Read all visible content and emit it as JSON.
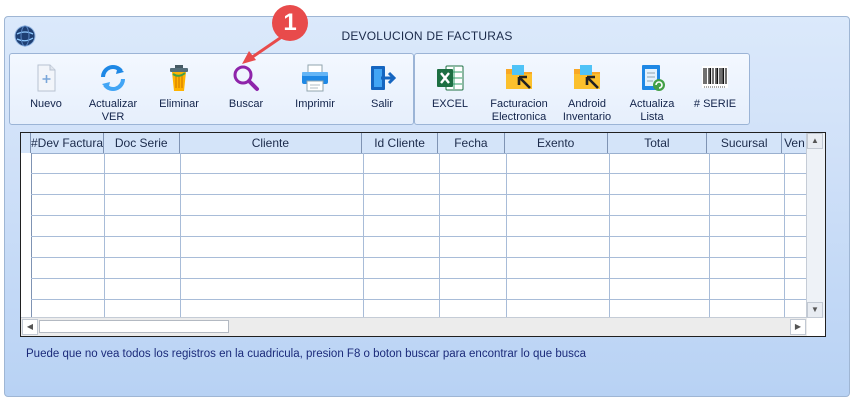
{
  "window": {
    "title": "DEVOLUCION DE FACTURAS"
  },
  "callout": {
    "number": "1"
  },
  "toolbar_left": [
    {
      "id": "nuevo",
      "label": "Nuevo",
      "icon": "doc-plus-icon"
    },
    {
      "id": "actualizar",
      "label": "Actualizar\nVER",
      "icon": "refresh-icon"
    },
    {
      "id": "eliminar",
      "label": "Eliminar",
      "icon": "trash-icon"
    },
    {
      "id": "buscar",
      "label": "Buscar",
      "icon": "search-icon"
    },
    {
      "id": "imprimir",
      "label": "Imprimir",
      "icon": "printer-icon"
    },
    {
      "id": "salir",
      "label": "Salir",
      "icon": "exit-icon"
    }
  ],
  "toolbar_right": [
    {
      "id": "excel",
      "label": "EXCEL",
      "icon": "excel-icon"
    },
    {
      "id": "facturacion",
      "label": "Facturacion\nElectronica",
      "icon": "folder-arrow-icon"
    },
    {
      "id": "android",
      "label": "Android\nInventario",
      "icon": "folder-arrow-icon"
    },
    {
      "id": "actualiza",
      "label": "Actualiza\nLista",
      "icon": "list-refresh-icon"
    },
    {
      "id": "serie",
      "label": "# SERIE",
      "icon": "barcode-icon"
    }
  ],
  "grid": {
    "columns": [
      "#Dev Factura",
      "Doc Serie",
      "Cliente",
      "Id Cliente",
      "Fecha",
      "Exento",
      "Total",
      "Sucursal",
      "Ven"
    ]
  },
  "status": {
    "message": "Puede que no vea todos los registros en la cuadricula, presion F8 o boton buscar para encontrar lo que busca"
  },
  "colors": {
    "accent": "#e84b4b",
    "header_bg": "#d4e4f9",
    "window_bg": "#cfe0f8"
  }
}
